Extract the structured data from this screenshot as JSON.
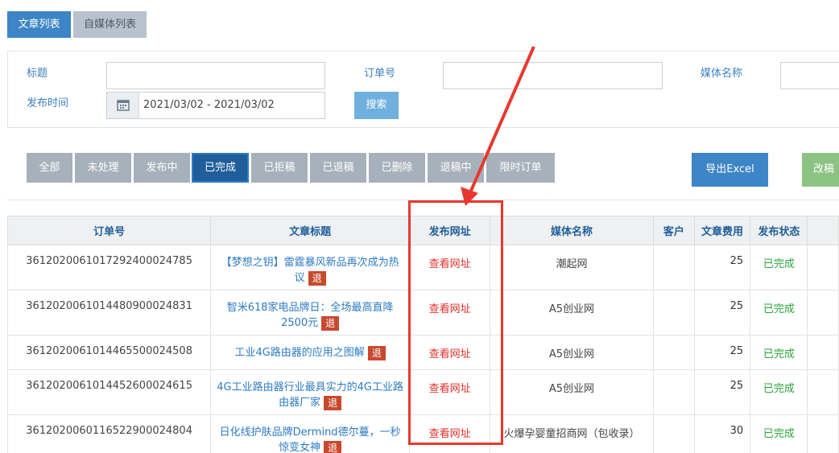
{
  "top_tabs": {
    "articles": "文章列表",
    "media": "自媒体列表"
  },
  "filters": {
    "title_label": "标题",
    "order_label": "订单号",
    "media_label": "媒体名称",
    "date_label": "发布时间",
    "date_value": "2021/03/02 - 2021/03/02",
    "search_label": "搜索"
  },
  "status_tabs": [
    "全部",
    "未处理",
    "发布中",
    "已完成",
    "已拒稿",
    "已退稿",
    "已删除",
    "退稿中",
    "限时订单"
  ],
  "active_status_tab": "已完成",
  "buttons": {
    "export": "导出Excel",
    "extra": "改稿"
  },
  "table": {
    "headers": [
      "订单号",
      "文章标题",
      "发布网址",
      "媒体名称",
      "客户",
      "文章费用",
      "发布状态"
    ],
    "retreat_badge": "退",
    "rows": [
      {
        "order": "3612020061017292400024785",
        "title": "【梦想之钥】雷霆暴风新品再次成为热议",
        "url": "查看网址",
        "media": "潮起网",
        "customer": "",
        "fee": "25",
        "status": "已完成"
      },
      {
        "order": "3612020061014480900024831",
        "title": "智米618家电品牌日：全场最高直降2500元",
        "url": "查看网址",
        "media": "A5创业网",
        "customer": "",
        "fee": "25",
        "status": "已完成"
      },
      {
        "order": "3612020061014465500024508",
        "title": "工业4G路由器的应用之图解",
        "url": "查看网址",
        "media": "A5创业网",
        "customer": "",
        "fee": "25",
        "status": "已完成"
      },
      {
        "order": "3612020061014452600024615",
        "title": "4G工业路由器行业最具实力的4G工业路由器厂家",
        "url": "查看网址",
        "media": "A5创业网",
        "customer": "",
        "fee": "25",
        "status": "已完成"
      },
      {
        "order": "3612020060116522900024804",
        "title": "日化线护肤品牌Dermind德尔蔓，一秒惊变女神",
        "url": "查看网址",
        "media": "火爆孕婴童招商网（包收录）",
        "customer": "",
        "fee": "30",
        "status": "已完成"
      }
    ]
  },
  "colors": {
    "accent": "#3d85c6",
    "annotation": "#e8382e",
    "link": "#2b7bc3",
    "success": "#2aa53a"
  }
}
